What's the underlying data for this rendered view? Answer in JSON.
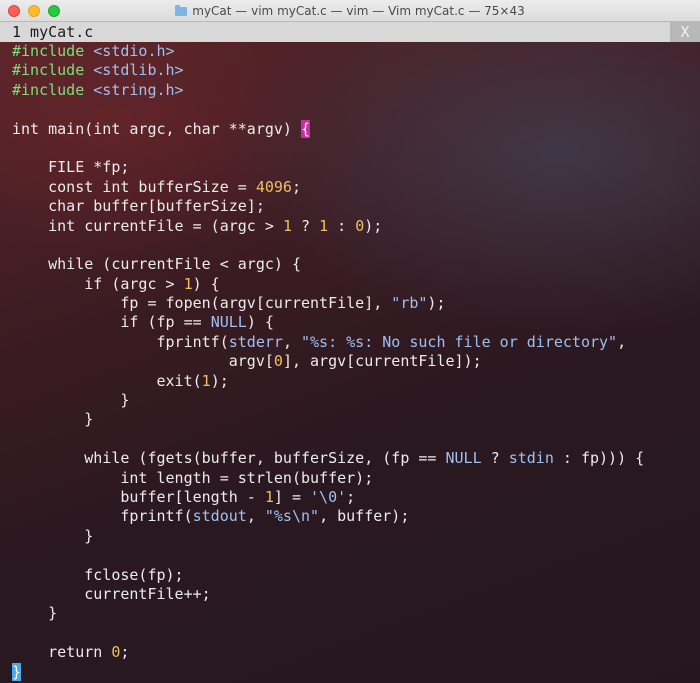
{
  "window": {
    "title": "myCat — vim myCat.c — vim — Vim myCat.c — 75×43"
  },
  "tabline": {
    "tab_label": "1 myCat.c",
    "close_label": "X"
  },
  "code_lines": [
    [
      {
        "t": "#include ",
        "c": "pp"
      },
      {
        "t": "<stdio.h>",
        "c": "str"
      }
    ],
    [
      {
        "t": "#include ",
        "c": "pp"
      },
      {
        "t": "<stdlib.h>",
        "c": "str"
      }
    ],
    [
      {
        "t": "#include ",
        "c": "pp"
      },
      {
        "t": "<string.h>",
        "c": "str"
      }
    ],
    [],
    [
      {
        "t": "int main(int argc, char **argv) "
      },
      {
        "t": "{",
        "c": "bracket-match"
      }
    ],
    [],
    [
      {
        "t": "    FILE *fp;"
      }
    ],
    [
      {
        "t": "    const int bufferSize = "
      },
      {
        "t": "4096",
        "c": "num"
      },
      {
        "t": ";"
      }
    ],
    [
      {
        "t": "    char buffer[bufferSize];"
      }
    ],
    [
      {
        "t": "    int currentFile = (argc > "
      },
      {
        "t": "1",
        "c": "num"
      },
      {
        "t": " ? "
      },
      {
        "t": "1",
        "c": "num"
      },
      {
        "t": " : "
      },
      {
        "t": "0",
        "c": "num"
      },
      {
        "t": ");"
      }
    ],
    [],
    [
      {
        "t": "    while (currentFile < argc) {"
      }
    ],
    [
      {
        "t": "        if (argc > "
      },
      {
        "t": "1",
        "c": "num"
      },
      {
        "t": ") {"
      }
    ],
    [
      {
        "t": "            fp = fopen(argv[currentFile], "
      },
      {
        "t": "\"rb\"",
        "c": "str"
      },
      {
        "t": ");"
      }
    ],
    [
      {
        "t": "            if (fp == "
      },
      {
        "t": "NULL",
        "c": "kw"
      },
      {
        "t": ") {"
      }
    ],
    [
      {
        "t": "                fprintf("
      },
      {
        "t": "stderr",
        "c": "kw"
      },
      {
        "t": ", "
      },
      {
        "t": "\"%s: %s: No such file or directory\"",
        "c": "str"
      },
      {
        "t": ","
      }
    ],
    [
      {
        "t": "                        argv["
      },
      {
        "t": "0",
        "c": "num"
      },
      {
        "t": "], argv[currentFile]);"
      }
    ],
    [
      {
        "t": "                exit("
      },
      {
        "t": "1",
        "c": "num"
      },
      {
        "t": ");"
      }
    ],
    [
      {
        "t": "            }"
      }
    ],
    [
      {
        "t": "        }"
      }
    ],
    [],
    [
      {
        "t": "        while (fgets(buffer, bufferSize, (fp == "
      },
      {
        "t": "NULL",
        "c": "kw"
      },
      {
        "t": " ? "
      },
      {
        "t": "stdin",
        "c": "kw"
      },
      {
        "t": " : fp))) {"
      }
    ],
    [
      {
        "t": "            int length = strlen(buffer);"
      }
    ],
    [
      {
        "t": "            buffer[length - "
      },
      {
        "t": "1",
        "c": "num"
      },
      {
        "t": "] = "
      },
      {
        "t": "'\\0'",
        "c": "str"
      },
      {
        "t": ";"
      }
    ],
    [
      {
        "t": "            fprintf("
      },
      {
        "t": "stdout",
        "c": "kw"
      },
      {
        "t": ", "
      },
      {
        "t": "\"%s\\n\"",
        "c": "str"
      },
      {
        "t": ", buffer);"
      }
    ],
    [
      {
        "t": "        }"
      }
    ],
    [],
    [
      {
        "t": "        fclose(fp);"
      }
    ],
    [
      {
        "t": "        currentFile++;"
      }
    ],
    [
      {
        "t": "    }"
      }
    ],
    [],
    [
      {
        "t": "    return "
      },
      {
        "t": "0",
        "c": "num"
      },
      {
        "t": ";"
      }
    ],
    [
      {
        "t": "}",
        "c": "cursor"
      }
    ]
  ]
}
